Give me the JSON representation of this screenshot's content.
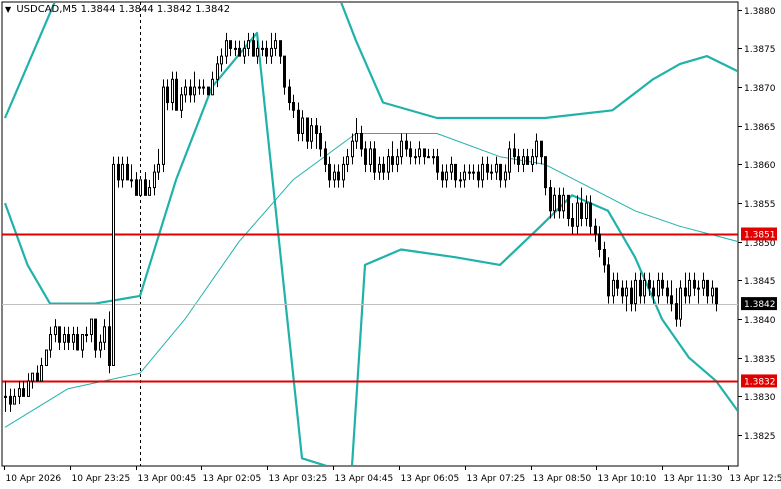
{
  "header": {
    "symbol": "USDCAD,M5",
    "ohlc": "1.3844 1.3844 1.3842 1.3842",
    "arrow_icon": "triangle-down-icon"
  },
  "colors": {
    "background": "#ffffff",
    "candle": "#000000",
    "bollinger_bands": "#20b2aa",
    "moving_average": "#20b2aa",
    "level_line": "#e00000",
    "price_line": "#c0c0c0",
    "current_price_box": "#000000",
    "level_label_box": "#e00000",
    "axis_text": "#000000"
  },
  "chart_data": {
    "type": "candlestick",
    "symbol": "USDCAD",
    "timeframe": "M5",
    "ylim": [
      1.3821,
      1.3881
    ],
    "y_ticks": [
      "1.3880",
      "1.3875",
      "1.3870",
      "1.3865",
      "1.3860",
      "1.3855",
      "1.3850",
      "1.3845",
      "1.3840",
      "1.3835",
      "1.3830",
      "1.3825"
    ],
    "x_ticks": [
      "10 Apr 2026",
      "10 Apr 23:25",
      "13 Apr 00:45",
      "13 Apr 02:05",
      "13 Apr 03:25",
      "13 Apr 04:45",
      "13 Apr 06:05",
      "13 Apr 07:25",
      "13 Apr 08:50",
      "13 Apr 10:10",
      "13 Apr 11:30",
      "13 Apr 12:50"
    ],
    "horizontal_levels": [
      {
        "value": 1.3851,
        "label": "1.3851"
      },
      {
        "value": 1.3832,
        "label": "1.3832"
      }
    ],
    "current_price": {
      "value": 1.3842,
      "label": "1.3842"
    },
    "session_separator_index": 30,
    "candles": [
      [
        1.383,
        1.3832,
        1.3828,
        1.383
      ],
      [
        1.383,
        1.3831,
        1.3828,
        1.3829
      ],
      [
        1.3829,
        1.3831,
        1.3829,
        1.383
      ],
      [
        1.383,
        1.3832,
        1.3829,
        1.3831
      ],
      [
        1.3831,
        1.3832,
        1.383,
        1.383
      ],
      [
        1.383,
        1.3833,
        1.383,
        1.3832
      ],
      [
        1.3832,
        1.3833,
        1.3831,
        1.3833
      ],
      [
        1.3833,
        1.3834,
        1.3832,
        1.3832
      ],
      [
        1.3832,
        1.3835,
        1.3832,
        1.3834
      ],
      [
        1.3834,
        1.3836,
        1.3834,
        1.3836
      ],
      [
        1.3836,
        1.3839,
        1.3835,
        1.3838
      ],
      [
        1.3838,
        1.384,
        1.3837,
        1.3839
      ],
      [
        1.3839,
        1.3839,
        1.3836,
        1.3837
      ],
      [
        1.3837,
        1.3839,
        1.3836,
        1.3838
      ],
      [
        1.3838,
        1.3839,
        1.3836,
        1.3837
      ],
      [
        1.3837,
        1.3839,
        1.3836,
        1.3838
      ],
      [
        1.3838,
        1.3839,
        1.3836,
        1.3836
      ],
      [
        1.3836,
        1.3838,
        1.3835,
        1.3838
      ],
      [
        1.3838,
        1.3839,
        1.3837,
        1.3838
      ],
      [
        1.3838,
        1.384,
        1.3837,
        1.384
      ],
      [
        1.384,
        1.384,
        1.3835,
        1.3836
      ],
      [
        1.3836,
        1.3838,
        1.3835,
        1.3837
      ],
      [
        1.3837,
        1.384,
        1.3836,
        1.3839
      ],
      [
        1.3839,
        1.3841,
        1.3833,
        1.3834
      ],
      [
        1.3834,
        1.3861,
        1.3834,
        1.386
      ],
      [
        1.386,
        1.3861,
        1.3857,
        1.3858
      ],
      [
        1.3858,
        1.3861,
        1.3857,
        1.386
      ],
      [
        1.386,
        1.3861,
        1.3858,
        1.3858
      ],
      [
        1.3858,
        1.386,
        1.3857,
        1.3858
      ],
      [
        1.3858,
        1.3859,
        1.3856,
        1.3856
      ],
      [
        1.3856,
        1.3858,
        1.3856,
        1.3858
      ],
      [
        1.3858,
        1.3859,
        1.3856,
        1.3856
      ],
      [
        1.3856,
        1.3858,
        1.3856,
        1.3857
      ],
      [
        1.3857,
        1.386,
        1.3856,
        1.3859
      ],
      [
        1.3859,
        1.3862,
        1.3858,
        1.386
      ],
      [
        1.386,
        1.3871,
        1.3859,
        1.387
      ],
      [
        1.387,
        1.3871,
        1.3867,
        1.3868
      ],
      [
        1.3868,
        1.3872,
        1.3867,
        1.3871
      ],
      [
        1.3871,
        1.3872,
        1.3867,
        1.3867
      ],
      [
        1.3867,
        1.387,
        1.3866,
        1.3869
      ],
      [
        1.3869,
        1.3871,
        1.3868,
        1.387
      ],
      [
        1.387,
        1.3871,
        1.3868,
        1.3869
      ],
      [
        1.3869,
        1.3872,
        1.3868,
        1.387
      ],
      [
        1.387,
        1.3871,
        1.3869,
        1.387
      ],
      [
        1.387,
        1.3871,
        1.3869,
        1.387
      ],
      [
        1.387,
        1.387,
        1.3869,
        1.3869
      ],
      [
        1.3869,
        1.3872,
        1.3869,
        1.3871
      ],
      [
        1.3871,
        1.3874,
        1.387,
        1.3873
      ],
      [
        1.3873,
        1.3875,
        1.3872,
        1.3874
      ],
      [
        1.3874,
        1.3877,
        1.3873,
        1.3876
      ],
      [
        1.3876,
        1.3876,
        1.3874,
        1.3875
      ],
      [
        1.3875,
        1.3876,
        1.3874,
        1.3875
      ],
      [
        1.3875,
        1.3876,
        1.3874,
        1.3874
      ],
      [
        1.3874,
        1.3876,
        1.3873,
        1.3875
      ],
      [
        1.3875,
        1.3877,
        1.3874,
        1.3876
      ],
      [
        1.3876,
        1.3877,
        1.3874,
        1.3874
      ],
      [
        1.3874,
        1.3876,
        1.3873,
        1.3875
      ],
      [
        1.3875,
        1.3876,
        1.3874,
        1.3875
      ],
      [
        1.3875,
        1.3876,
        1.3873,
        1.3874
      ],
      [
        1.3874,
        1.3877,
        1.3873,
        1.3875
      ],
      [
        1.3875,
        1.3877,
        1.3874,
        1.3876
      ],
      [
        1.3876,
        1.3876,
        1.3873,
        1.3874
      ],
      [
        1.3874,
        1.3874,
        1.3869,
        1.387
      ],
      [
        1.387,
        1.3871,
        1.3867,
        1.3868
      ],
      [
        1.3868,
        1.3869,
        1.3866,
        1.3867
      ],
      [
        1.3867,
        1.3868,
        1.3863,
        1.3864
      ],
      [
        1.3864,
        1.3867,
        1.3863,
        1.3866
      ],
      [
        1.3866,
        1.3866,
        1.3862,
        1.3863
      ],
      [
        1.3863,
        1.3866,
        1.3862,
        1.3865
      ],
      [
        1.3865,
        1.3866,
        1.3862,
        1.3864
      ],
      [
        1.3864,
        1.3865,
        1.3861,
        1.3862
      ],
      [
        1.3862,
        1.3863,
        1.3859,
        1.386
      ],
      [
        1.386,
        1.3861,
        1.3857,
        1.3858
      ],
      [
        1.3858,
        1.386,
        1.3857,
        1.3859
      ],
      [
        1.3859,
        1.386,
        1.3857,
        1.3858
      ],
      [
        1.3858,
        1.3861,
        1.3857,
        1.386
      ],
      [
        1.386,
        1.3862,
        1.3859,
        1.3861
      ],
      [
        1.3861,
        1.3864,
        1.386,
        1.3863
      ],
      [
        1.3863,
        1.3866,
        1.3862,
        1.3864
      ],
      [
        1.3864,
        1.3865,
        1.3861,
        1.3862
      ],
      [
        1.3862,
        1.3863,
        1.3859,
        1.386
      ],
      [
        1.386,
        1.3863,
        1.3859,
        1.3862
      ],
      [
        1.3862,
        1.3863,
        1.3858,
        1.3859
      ],
      [
        1.3859,
        1.3861,
        1.3858,
        1.386
      ],
      [
        1.386,
        1.3861,
        1.3858,
        1.3859
      ],
      [
        1.3859,
        1.3862,
        1.3858,
        1.3861
      ],
      [
        1.3861,
        1.3863,
        1.3859,
        1.386
      ],
      [
        1.386,
        1.3862,
        1.3859,
        1.3861
      ],
      [
        1.3861,
        1.3864,
        1.386,
        1.3863
      ],
      [
        1.3863,
        1.3864,
        1.3861,
        1.3862
      ],
      [
        1.3862,
        1.3863,
        1.386,
        1.3861
      ],
      [
        1.3861,
        1.3862,
        1.386,
        1.3861
      ],
      [
        1.3861,
        1.3863,
        1.386,
        1.3862
      ],
      [
        1.3862,
        1.3862,
        1.386,
        1.3861
      ],
      [
        1.3861,
        1.3862,
        1.3861,
        1.3861
      ],
      [
        1.3861,
        1.3862,
        1.386,
        1.3861
      ],
      [
        1.3861,
        1.3862,
        1.3858,
        1.3859
      ],
      [
        1.3859,
        1.386,
        1.3857,
        1.3858
      ],
      [
        1.3858,
        1.386,
        1.3857,
        1.3859
      ],
      [
        1.3859,
        1.3861,
        1.3858,
        1.386
      ],
      [
        1.386,
        1.386,
        1.3857,
        1.3858
      ],
      [
        1.3858,
        1.3859,
        1.3857,
        1.3858
      ],
      [
        1.3858,
        1.386,
        1.3857,
        1.3859
      ],
      [
        1.3859,
        1.386,
        1.3858,
        1.3859
      ],
      [
        1.3859,
        1.386,
        1.3858,
        1.3859
      ],
      [
        1.3859,
        1.386,
        1.3857,
        1.3858
      ],
      [
        1.3858,
        1.3861,
        1.3857,
        1.386
      ],
      [
        1.386,
        1.3861,
        1.3858,
        1.3859
      ],
      [
        1.3859,
        1.386,
        1.3858,
        1.3859
      ],
      [
        1.3859,
        1.3861,
        1.3858,
        1.386
      ],
      [
        1.386,
        1.386,
        1.3857,
        1.3858
      ],
      [
        1.3858,
        1.386,
        1.3857,
        1.3859
      ],
      [
        1.3859,
        1.3863,
        1.3858,
        1.3862
      ],
      [
        1.3862,
        1.3864,
        1.386,
        1.3861
      ],
      [
        1.3861,
        1.3862,
        1.3859,
        1.386
      ],
      [
        1.386,
        1.3862,
        1.3859,
        1.3861
      ],
      [
        1.3861,
        1.3862,
        1.386,
        1.386
      ],
      [
        1.386,
        1.3862,
        1.3859,
        1.3861
      ],
      [
        1.3861,
        1.3864,
        1.386,
        1.3863
      ],
      [
        1.3863,
        1.3863,
        1.386,
        1.3861
      ],
      [
        1.3861,
        1.3861,
        1.3856,
        1.3857
      ],
      [
        1.3857,
        1.3858,
        1.3853,
        1.3854
      ],
      [
        1.3854,
        1.3857,
        1.3853,
        1.3856
      ],
      [
        1.3856,
        1.3857,
        1.3853,
        1.3854
      ],
      [
        1.3854,
        1.3857,
        1.3853,
        1.3856
      ],
      [
        1.3856,
        1.3856,
        1.3852,
        1.3853
      ],
      [
        1.3853,
        1.3855,
        1.3851,
        1.3852
      ],
      [
        1.3852,
        1.3856,
        1.3851,
        1.3855
      ],
      [
        1.3855,
        1.3857,
        1.3852,
        1.3853
      ],
      [
        1.3853,
        1.3856,
        1.3852,
        1.3855
      ],
      [
        1.3855,
        1.3856,
        1.3851,
        1.3852
      ],
      [
        1.3852,
        1.3853,
        1.385,
        1.3851
      ],
      [
        1.3851,
        1.3852,
        1.3848,
        1.3849
      ],
      [
        1.3849,
        1.385,
        1.3846,
        1.3847
      ],
      [
        1.3847,
        1.3848,
        1.3842,
        1.3843
      ],
      [
        1.3843,
        1.3846,
        1.3842,
        1.3845
      ],
      [
        1.3845,
        1.3846,
        1.3843,
        1.3844
      ],
      [
        1.3844,
        1.3845,
        1.3842,
        1.3843
      ],
      [
        1.3843,
        1.3845,
        1.3841,
        1.3844
      ],
      [
        1.3844,
        1.3845,
        1.3841,
        1.3842
      ],
      [
        1.3842,
        1.3846,
        1.3841,
        1.3845
      ],
      [
        1.3845,
        1.3846,
        1.3842,
        1.3843
      ],
      [
        1.3843,
        1.3846,
        1.3842,
        1.3845
      ],
      [
        1.3845,
        1.3846,
        1.3843,
        1.3844
      ],
      [
        1.3844,
        1.3845,
        1.3842,
        1.3843
      ],
      [
        1.3843,
        1.3846,
        1.3842,
        1.3845
      ],
      [
        1.3845,
        1.3846,
        1.3843,
        1.3844
      ],
      [
        1.3844,
        1.3845,
        1.3842,
        1.3843
      ],
      [
        1.3843,
        1.3845,
        1.3841,
        1.3842
      ],
      [
        1.3842,
        1.3844,
        1.3839,
        1.384
      ],
      [
        1.384,
        1.3845,
        1.3839,
        1.3844
      ],
      [
        1.3844,
        1.3846,
        1.3842,
        1.3843
      ],
      [
        1.3843,
        1.3846,
        1.3842,
        1.3845
      ],
      [
        1.3845,
        1.3846,
        1.3843,
        1.3844
      ],
      [
        1.3844,
        1.3845,
        1.3842,
        1.3844
      ],
      [
        1.3844,
        1.3846,
        1.3843,
        1.3845
      ],
      [
        1.3845,
        1.3845,
        1.3842,
        1.3843
      ],
      [
        1.3843,
        1.3845,
        1.3842,
        1.3844
      ],
      [
        1.3844,
        1.3844,
        1.3841,
        1.3842
      ]
    ],
    "upper_band": [
      [
        0,
        1.3866
      ],
      [
        14,
        1.3885
      ],
      [
        30,
        1.3884
      ],
      [
        40,
        1.3884
      ],
      [
        60,
        1.3887
      ],
      [
        70,
        1.3888
      ],
      [
        78,
        1.3876
      ],
      [
        84,
        1.3868
      ],
      [
        96,
        1.3866
      ],
      [
        120,
        1.3866
      ],
      [
        135,
        1.3867
      ],
      [
        144,
        1.3871
      ],
      [
        150,
        1.3873
      ],
      [
        156,
        1.3874
      ],
      [
        163,
        1.3872
      ]
    ],
    "middle_band": [
      [
        0,
        1.3826
      ],
      [
        14,
        1.3831
      ],
      [
        30,
        1.3833
      ],
      [
        40,
        1.384
      ],
      [
        52,
        1.385
      ],
      [
        64,
        1.3858
      ],
      [
        78,
        1.3864
      ],
      [
        96,
        1.3864
      ],
      [
        110,
        1.3861
      ],
      [
        120,
        1.386
      ],
      [
        130,
        1.3857
      ],
      [
        140,
        1.3854
      ],
      [
        150,
        1.3852
      ],
      [
        163,
        1.385
      ]
    ],
    "lower_band": [
      [
        0,
        1.3855
      ],
      [
        5,
        1.3847
      ],
      [
        10,
        1.3842
      ],
      [
        20,
        1.3842
      ],
      [
        30,
        1.3843
      ],
      [
        38,
        1.3858
      ],
      [
        46,
        1.387
      ],
      [
        56,
        1.3877
      ],
      [
        66,
        1.3822
      ],
      [
        77,
        1.382
      ],
      [
        80,
        1.3847
      ],
      [
        88,
        1.3849
      ],
      [
        100,
        1.3848
      ],
      [
        110,
        1.3847
      ],
      [
        119,
        1.3852
      ],
      [
        126,
        1.3856
      ],
      [
        134,
        1.3854
      ],
      [
        140,
        1.3848
      ],
      [
        146,
        1.384
      ],
      [
        152,
        1.3835
      ],
      [
        158,
        1.3832
      ],
      [
        163,
        1.3828
      ]
    ]
  }
}
